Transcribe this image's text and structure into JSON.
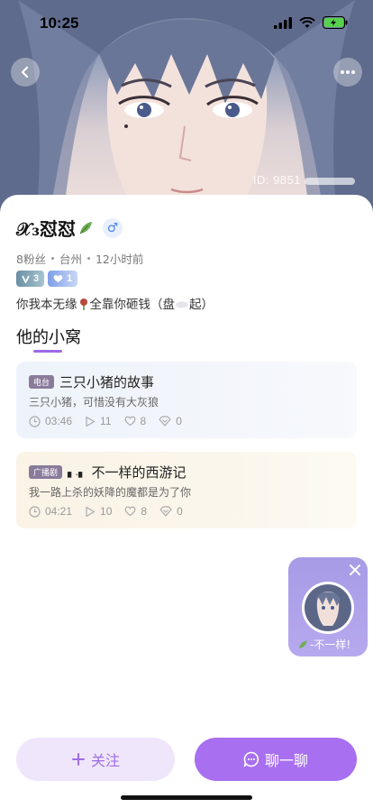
{
  "status_bar": {
    "time": "10:25"
  },
  "hero": {
    "id_label": "ID: 9851"
  },
  "profile": {
    "name": "𝒳₃怼怼",
    "gender": "♂",
    "fans": "8粉丝",
    "location": "台州",
    "last_active": "12小时前",
    "badges": [
      {
        "label": "3"
      },
      {
        "label": "1"
      }
    ],
    "signature_before": "你我本无缘",
    "signature_after": "全靠你砸钱（盘",
    "signature_end": "起）"
  },
  "section": {
    "title": "他的小窝"
  },
  "cards": [
    {
      "tag": "电台",
      "title": "三只小猪的故事",
      "subtitle": "三只小猪，可惜没有大灰狼",
      "duration": "03:46",
      "plays": "11",
      "likes": "8",
      "gifts": "0"
    },
    {
      "tag": "广播剧",
      "title_prefix": "▖.▖",
      "title": "不一样的西游记",
      "subtitle": "我一路上杀的妖降的魔都是为了你",
      "duration": "04:21",
      "plays": "10",
      "likes": "8",
      "gifts": "0"
    }
  ],
  "float_player": {
    "label": "-不一样!"
  },
  "actions": {
    "follow": "关注",
    "chat": "聊一聊"
  },
  "colors": {
    "accent": "#a86ff0",
    "follow_bg": "#efe6fb",
    "float_bg": "#a79be6"
  },
  "icons": [
    "signal-icon",
    "wifi-icon",
    "battery-icon",
    "back-icon",
    "more-icon",
    "leaf-icon",
    "clock-icon",
    "play-icon",
    "heart-icon",
    "gift-icon",
    "close-icon",
    "plus-icon",
    "chat-icon"
  ]
}
